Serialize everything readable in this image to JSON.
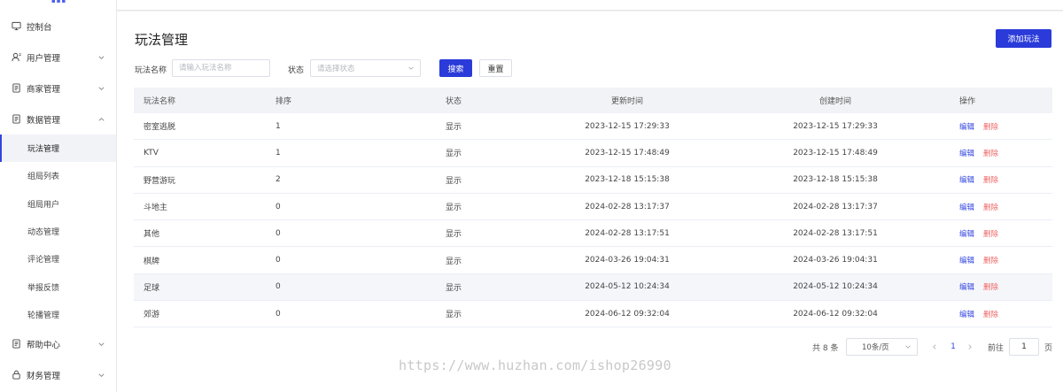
{
  "sidebar": {
    "items": [
      {
        "label": "控制台",
        "icon": "monitor-icon",
        "expandable": false
      },
      {
        "label": "用户管理",
        "icon": "user-icon",
        "expandable": true,
        "expanded": false
      },
      {
        "label": "商家管理",
        "icon": "document-icon",
        "expandable": true,
        "expanded": false
      },
      {
        "label": "数据管理",
        "icon": "document-icon",
        "expandable": true,
        "expanded": true
      },
      {
        "label": "帮助中心",
        "icon": "document-icon",
        "expandable": true,
        "expanded": false
      },
      {
        "label": "财务管理",
        "icon": "lock-icon",
        "expandable": true,
        "expanded": false
      }
    ],
    "sub_items": [
      {
        "label": "玩法管理",
        "active": true
      },
      {
        "label": "组局列表",
        "active": false
      },
      {
        "label": "组局用户",
        "active": false
      },
      {
        "label": "动态管理",
        "active": false
      },
      {
        "label": "评论管理",
        "active": false
      },
      {
        "label": "举报反馈",
        "active": false
      },
      {
        "label": "轮播管理",
        "active": false
      }
    ]
  },
  "page": {
    "title": "玩法管理",
    "add_button": "添加玩法"
  },
  "filters": {
    "name_label": "玩法名称",
    "name_placeholder": "请输入玩法名称",
    "status_label": "状态",
    "status_placeholder": "请选择状态",
    "search_button": "搜索",
    "reset_button": "重置"
  },
  "table": {
    "headers": [
      "玩法名称",
      "排序",
      "状态",
      "更新时间",
      "创建时间",
      "操作"
    ],
    "edit_label": "编辑",
    "delete_label": "删除",
    "rows": [
      {
        "name": "密室逃脱",
        "sort": "1",
        "status": "显示",
        "updated": "2023-12-15 17:29:33",
        "created": "2023-12-15 17:29:33"
      },
      {
        "name": "KTV",
        "sort": "1",
        "status": "显示",
        "updated": "2023-12-15 17:48:49",
        "created": "2023-12-15 17:48:49"
      },
      {
        "name": "野营游玩",
        "sort": "2",
        "status": "显示",
        "updated": "2023-12-18 15:15:38",
        "created": "2023-12-18 15:15:38"
      },
      {
        "name": "斗地主",
        "sort": "0",
        "status": "显示",
        "updated": "2024-02-28 13:17:37",
        "created": "2024-02-28 13:17:37"
      },
      {
        "name": "其他",
        "sort": "0",
        "status": "显示",
        "updated": "2024-02-28 13:17:51",
        "created": "2024-02-28 13:17:51"
      },
      {
        "name": "棋牌",
        "sort": "0",
        "status": "显示",
        "updated": "2024-03-26 19:04:31",
        "created": "2024-03-26 19:04:31"
      },
      {
        "name": "足球",
        "sort": "0",
        "status": "显示",
        "updated": "2024-05-12 10:24:34",
        "created": "2024-05-12 10:24:34"
      },
      {
        "name": "郊游",
        "sort": "0",
        "status": "显示",
        "updated": "2024-06-12 09:32:04",
        "created": "2024-06-12 09:32:04"
      }
    ]
  },
  "pagination": {
    "total": "共 8 条",
    "page_size": "10条/页",
    "current_page": "1",
    "goto_label": "前往",
    "goto_value": "1",
    "page_suffix": "页"
  },
  "watermark": "https://www.huzhan.com/ishop26990",
  "colors": {
    "primary": "#2a3bd9",
    "danger": "#f06464",
    "active_bar": "#3346e0"
  }
}
